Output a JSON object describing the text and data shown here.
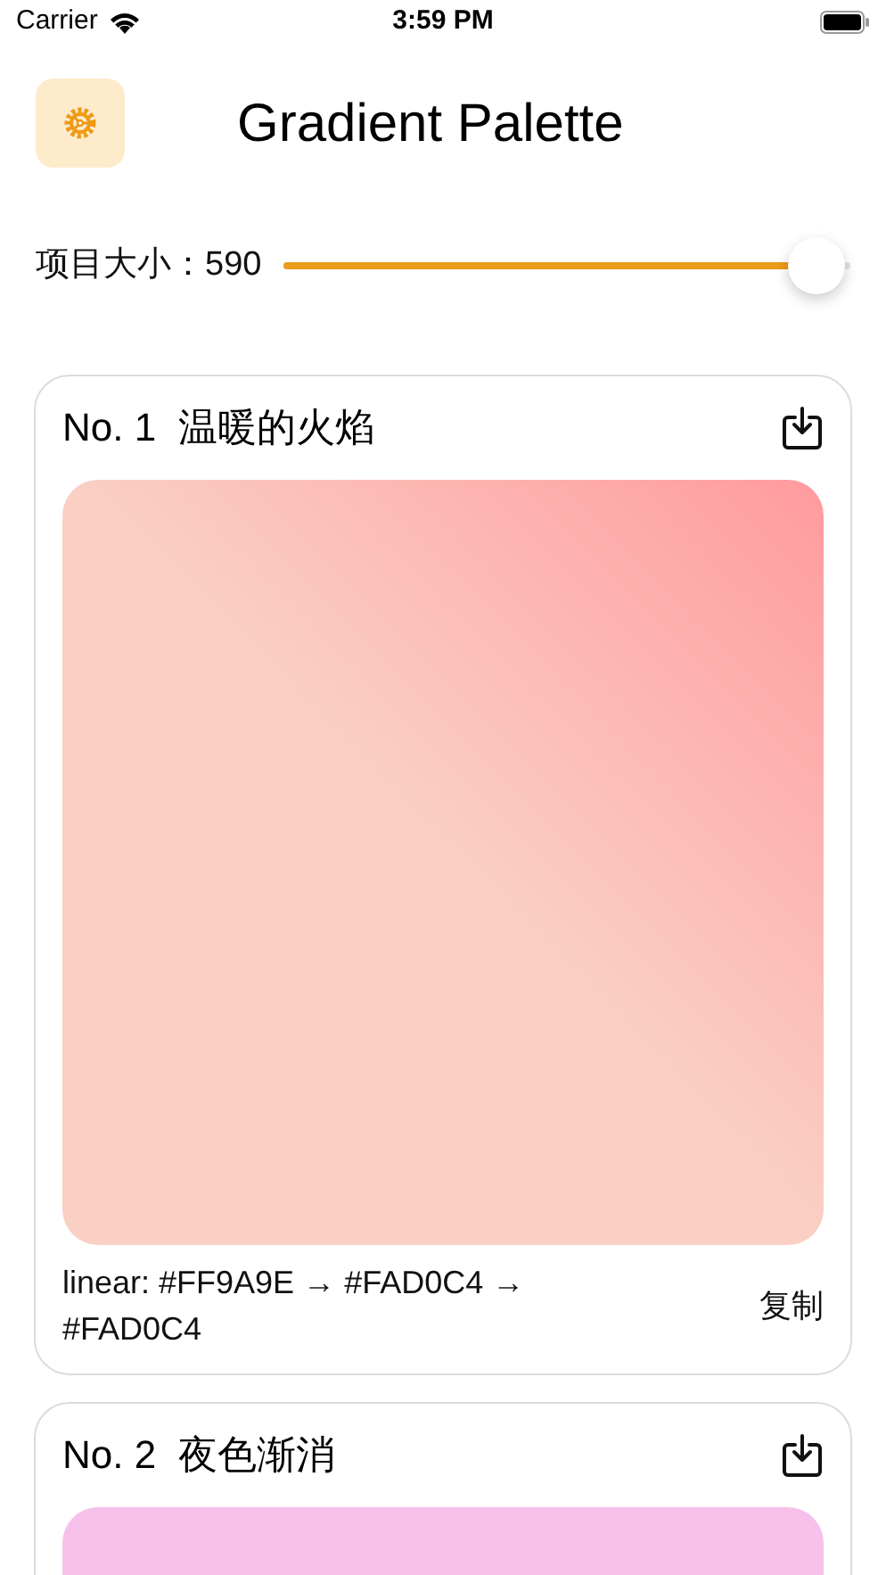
{
  "status_bar": {
    "carrier": "Carrier",
    "time": "3:59 PM"
  },
  "header": {
    "title": "Gradient Palette"
  },
  "size_slider": {
    "label": "项目大小：",
    "value": "590",
    "level": 0.94
  },
  "cards": [
    {
      "title": "No. 1  温暖的火焰",
      "stops": [
        {
          "color": "#ff9a9e"
        },
        {
          "color": "#fad0c4"
        },
        {
          "color": "#fad0c4"
        }
      ],
      "description": "linear: #FF9A9E → #FAD0C4 → #FAD0C4",
      "copy": "复制"
    },
    {
      "title": "No. 2  夜色渐消",
      "stops": [
        {
          "color": "#f6c0ea"
        },
        {
          "color": "#f6c0ea"
        }
      ]
    }
  ]
}
